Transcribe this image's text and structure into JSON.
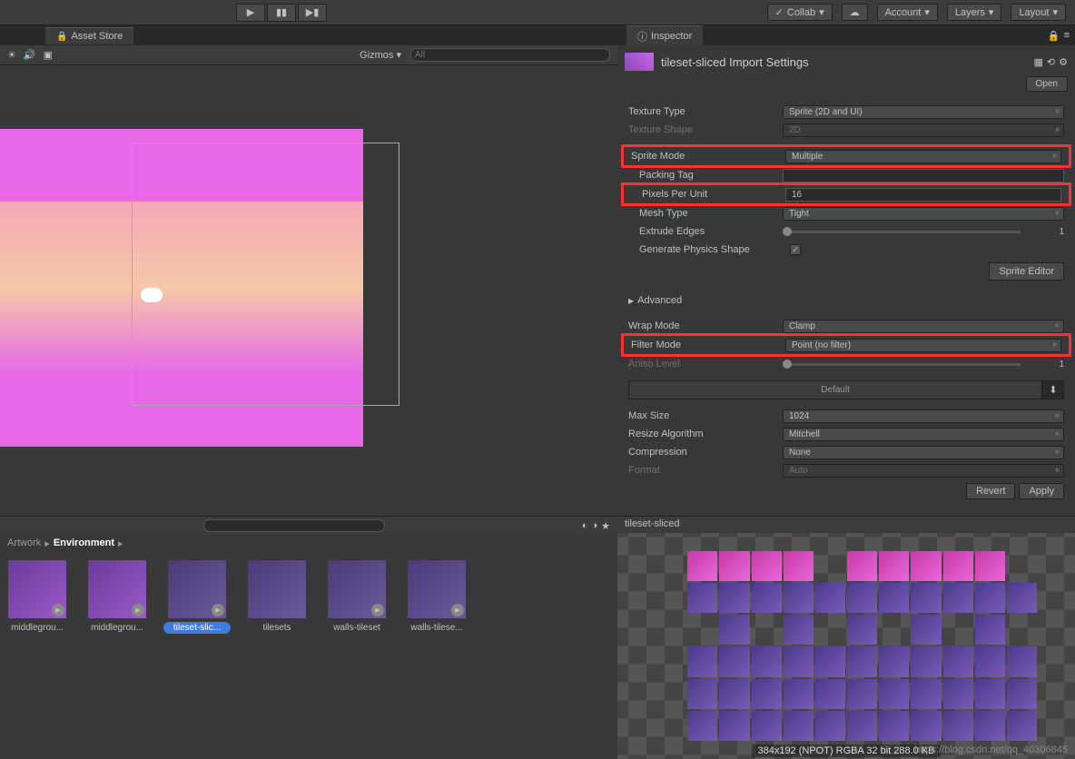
{
  "toolbar": {
    "collab": "Collab",
    "account": "Account",
    "layers": "Layers",
    "layout": "Layout"
  },
  "scene": {
    "tab": "Asset Store",
    "gizmos": "Gizmos",
    "search": "All"
  },
  "inspector": {
    "tab": "Inspector",
    "asset_title": "tileset-sliced Import Settings",
    "open": "Open",
    "texture_type_label": "Texture Type",
    "texture_type_value": "Sprite (2D and UI)",
    "texture_shape_label": "Texture Shape",
    "texture_shape_value": "2D",
    "sprite_mode_label": "Sprite Mode",
    "sprite_mode_value": "Multiple",
    "packing_tag_label": "Packing Tag",
    "pixels_per_unit_label": "Pixels Per Unit",
    "pixels_per_unit_value": "16",
    "mesh_type_label": "Mesh Type",
    "mesh_type_value": "Tight",
    "extrude_edges_label": "Extrude Edges",
    "extrude_edges_value": "1",
    "generate_physics_label": "Generate Physics Shape",
    "sprite_editor": "Sprite Editor",
    "advanced": "Advanced",
    "wrap_mode_label": "Wrap Mode",
    "wrap_mode_value": "Clamp",
    "filter_mode_label": "Filter Mode",
    "filter_mode_value": "Point (no filter)",
    "aniso_level_label": "Aniso Level",
    "aniso_level_value": "1",
    "default_tab": "Default",
    "max_size_label": "Max Size",
    "max_size_value": "1024",
    "resize_algorithm_label": "Resize Algorithm",
    "resize_algorithm_value": "Mitchell",
    "compression_label": "Compression",
    "compression_value": "None",
    "format_label": "Format",
    "format_value": "Auto",
    "revert": "Revert",
    "apply": "Apply"
  },
  "breadcrumb": {
    "artwork": "Artwork",
    "environment": "Environment"
  },
  "assets": {
    "item0": "middlegrou...",
    "item1": "middlegrou...",
    "item2": "tileset-slic...",
    "item3": "tilesets",
    "item4": "walls-tileset",
    "item5": "walls-tilese..."
  },
  "preview": {
    "title": "tileset-sliced",
    "info": "384x192 (NPOT)  RGBA 32 bit   288.0 KB"
  },
  "watermark": "https://blog.csdn.net/qq_40306845"
}
